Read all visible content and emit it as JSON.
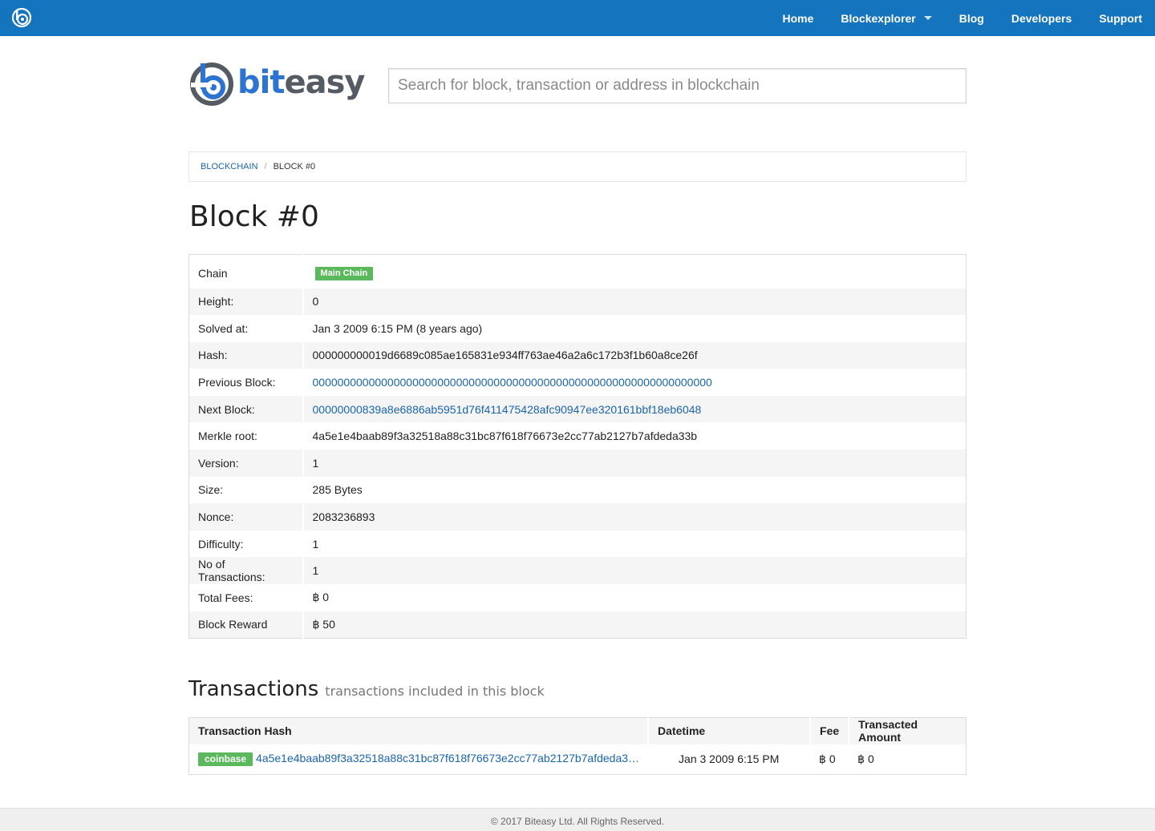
{
  "nav": {
    "logo": "biteasy-icon",
    "links": [
      "Home",
      "Blockexplorer",
      "Blog",
      "Developers",
      "Support"
    ]
  },
  "brand": {
    "text_part1": "bit",
    "text_part2": "easy"
  },
  "search": {
    "placeholder": "Search for block, transaction or address in blockchain"
  },
  "breadcrumb": {
    "root": "BLOCKCHAIN",
    "current": "BLOCK #0"
  },
  "page_title": "Block #0",
  "block": {
    "chain_label": "Chain",
    "chain_badge": "Main Chain",
    "rows": [
      {
        "label": "Height:",
        "value": "0"
      },
      {
        "label": "Solved at:",
        "value": "Jan 3 2009 6:15 PM (8 years ago)"
      },
      {
        "label": "Hash:",
        "value": "000000000019d6689c085ae165831e934ff763ae46a2a6c172b3f1b60a8ce26f"
      },
      {
        "label": "Previous Block:",
        "value": "0000000000000000000000000000000000000000000000000000000000000000"
      },
      {
        "label": "Next Block:",
        "value": "00000000839a8e6886ab5951d76f411475428afc90947ee320161bbf18eb6048"
      },
      {
        "label": "Merkle root:",
        "value": "4a5e1e4baab89f3a32518a88c31bc87f618f76673e2cc77ab2127b7afdeda33b"
      },
      {
        "label": "Version:",
        "value": "1"
      },
      {
        "label": "Size:",
        "value": "285 Bytes"
      },
      {
        "label": "Nonce:",
        "value": "2083236893"
      },
      {
        "label": "Difficulty:",
        "value": "1"
      },
      {
        "label": "No of Transactions:",
        "value": "1"
      },
      {
        "label": "Total Fees:",
        "value": "฿ 0"
      },
      {
        "label": "Block Reward",
        "value": "฿ 50"
      }
    ]
  },
  "transactions": {
    "heading": "Transactions",
    "subheading": "transactions included in this block",
    "columns": [
      "Transaction Hash",
      "Datetime",
      "Fee",
      "Transacted Amount"
    ],
    "rows": [
      {
        "badge": "coinbase",
        "hash": "4a5e1e4baab89f3a32518a88c31bc87f618f76673e2cc77ab2127b7afdeda3…",
        "datetime": "Jan 3 2009 6:15 PM",
        "fee": "฿ 0",
        "amount": "฿ 0"
      }
    ]
  },
  "footer": {
    "text": "© 2017 Biteasy Ltd. All Rights Reserved."
  },
  "colors": {
    "navbar": "#1474be",
    "link": "#1a65ac",
    "badge_green": "#5cb85c",
    "brand_blue": "#2c73d2",
    "brand_gray": "#555b62"
  }
}
